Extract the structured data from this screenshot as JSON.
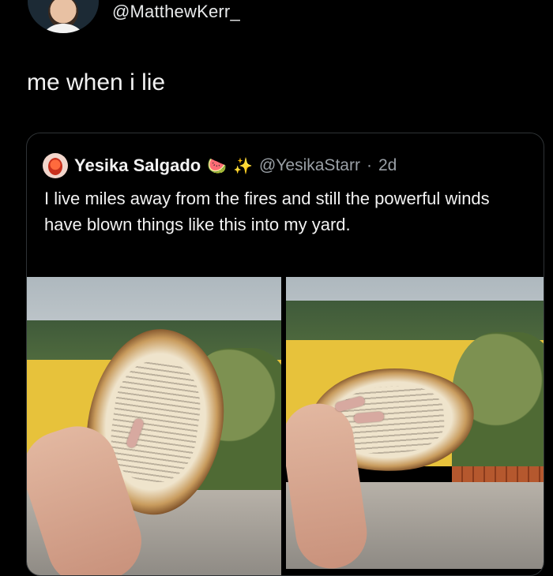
{
  "outer_tweet": {
    "handle": "@MatthewKerr_",
    "text": "me when i lie"
  },
  "quoted_tweet": {
    "display_name": "Yesika Salgado",
    "emojis": [
      "watermelon",
      "sparkles"
    ],
    "handle": "@YesikaStarr",
    "separator": "·",
    "timestamp": "2d",
    "text": "I live miles away from the fires and still the powerful winds have blown things like this into my yard.",
    "photos": [
      {
        "description_icon": "burned-book-page-photo"
      },
      {
        "description_icon": "burned-book-page-photo"
      }
    ]
  },
  "colors": {
    "background": "#000000",
    "text": "#e7e9ea",
    "secondary_text": "#9aa0a6",
    "card_border": "#2f3336"
  }
}
